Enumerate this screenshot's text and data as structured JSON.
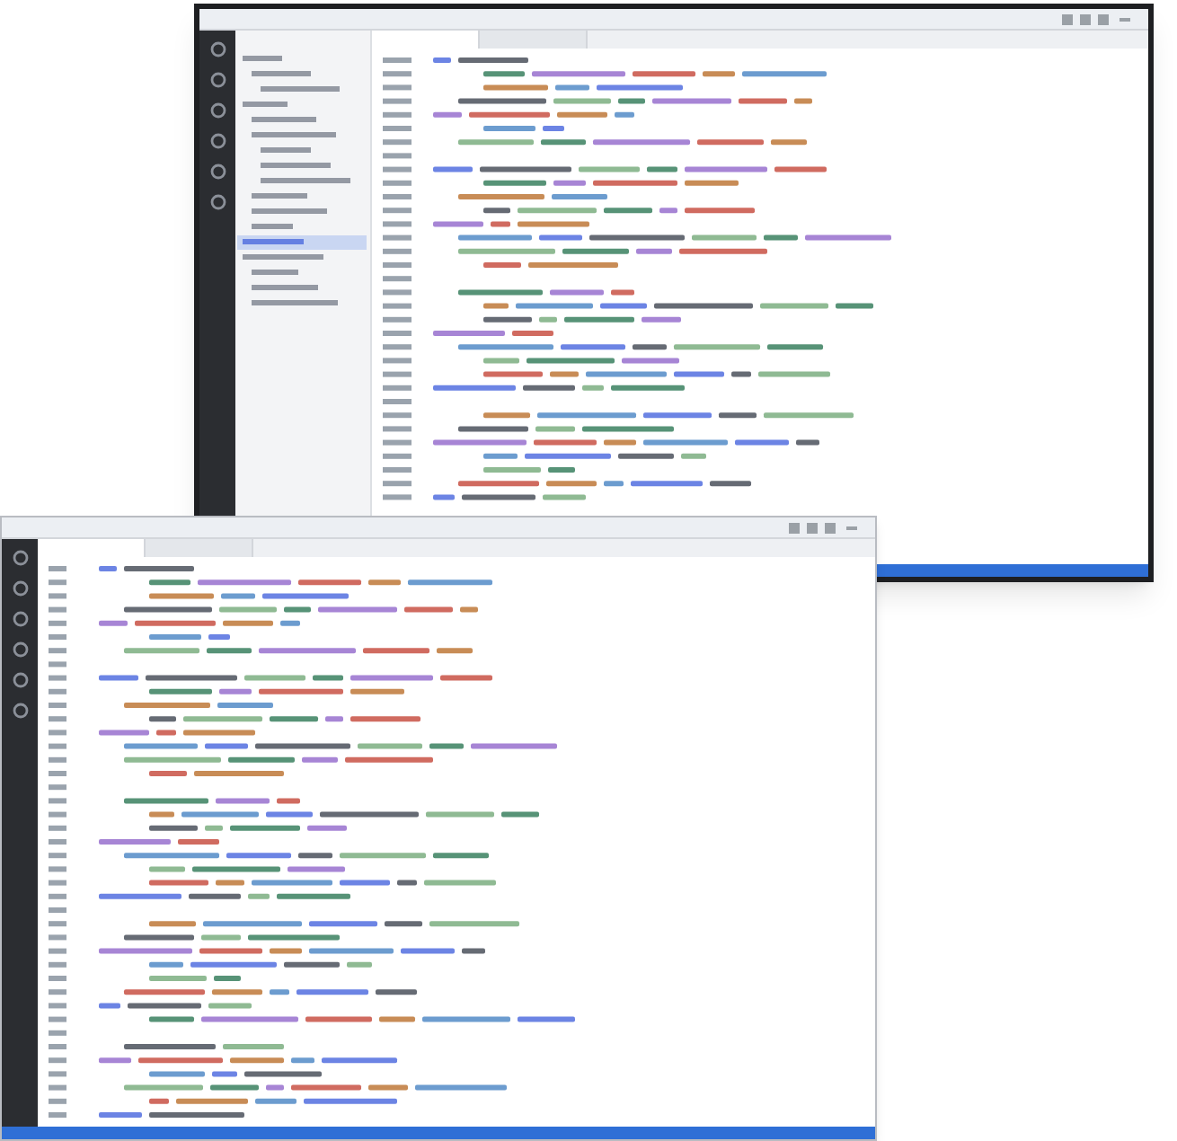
{
  "windows": [
    {
      "kind": "dark",
      "sidebar": true
    },
    {
      "kind": "light",
      "sidebar": false
    }
  ]
}
